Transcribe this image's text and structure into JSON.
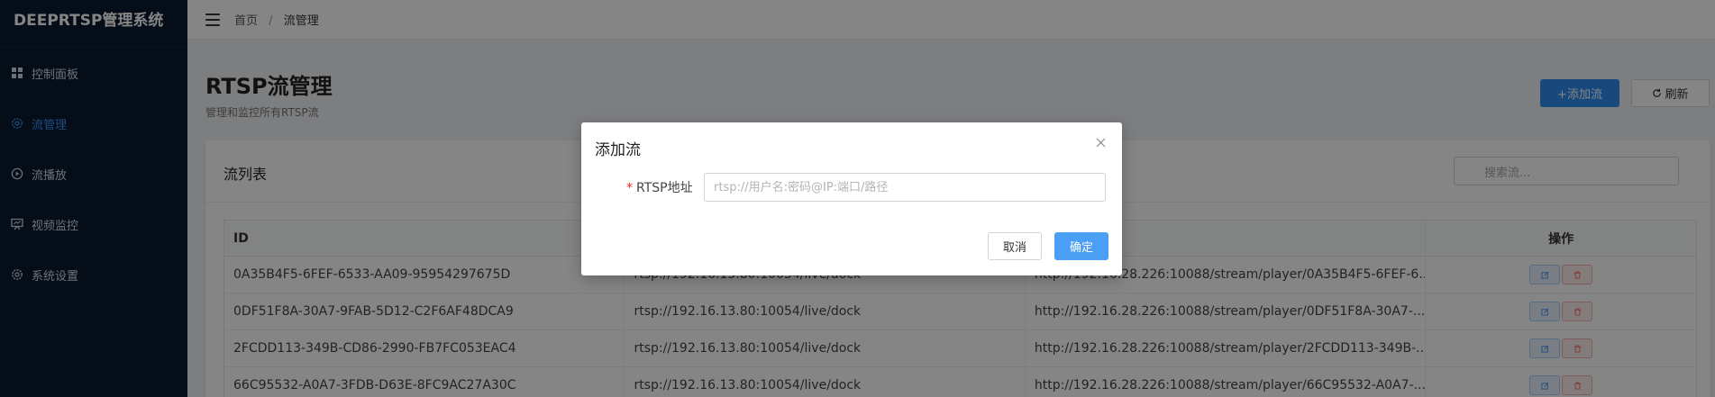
{
  "sidebar": {
    "brand": "DEEPRTSP管理系统",
    "items": [
      {
        "label": "控制面板",
        "icon": "dashboard-icon"
      },
      {
        "label": "流管理",
        "icon": "gear-icon",
        "active": true
      },
      {
        "label": "流播放",
        "icon": "play-circle-icon"
      },
      {
        "label": "视频监控",
        "icon": "monitor-icon"
      },
      {
        "label": "系统设置",
        "icon": "gear-icon"
      }
    ]
  },
  "header": {
    "breadcrumb": {
      "home": "首页",
      "separator": "/",
      "current": "流管理"
    }
  },
  "main": {
    "title": "RTSP流管理",
    "subtitle": "管理和监控所有RTSP流",
    "add_button": "+添加流",
    "refresh_button": "刷新"
  },
  "card": {
    "title": "流列表",
    "search_placeholder": "搜索流..."
  },
  "table": {
    "headers": [
      "ID",
      "",
      "",
      "操作"
    ],
    "rows": [
      [
        "0A35B4F5-6FEF-6533-AA09-95954297675D",
        "rtsp://192.16.13.80:10054/live/dock",
        "http://192.16.28.226:10088/stream/player/0A35B4F5-6FEF-6..."
      ],
      [
        "0DF51F8A-30A7-9FAB-5D12-C2F6AF48DCA9",
        "rtsp://192.16.13.80:10054/live/dock",
        "http://192.16.28.226:10088/stream/player/0DF51F8A-30A7-..."
      ],
      [
        "2FCDD113-349B-CD86-2990-FB7FC053EAC4",
        "rtsp://192.16.13.80:10054/live/dock",
        "http://192.16.28.226:10088/stream/player/2FCDD113-349B-..."
      ],
      [
        "66C95532-A0A7-3FDB-D63E-8FC9AC27A30C",
        "rtsp://192.16.13.80:10054/live/dock",
        "http://192.16.28.226:10088/stream/player/66C95532-A0A7-..."
      ]
    ]
  },
  "dialog": {
    "title": "添加流",
    "required_mark": "*",
    "label": "RTSP地址",
    "input_value": "",
    "input_placeholder": "rtsp://用户名:密码@IP:端口/路径",
    "cancel": "取消",
    "confirm": "确定"
  },
  "colors": {
    "sidebar_bg": "#0b1a2e",
    "accent": "#2d8cf0",
    "active_menu": "#3d8ff5",
    "danger": "#f5222d"
  }
}
